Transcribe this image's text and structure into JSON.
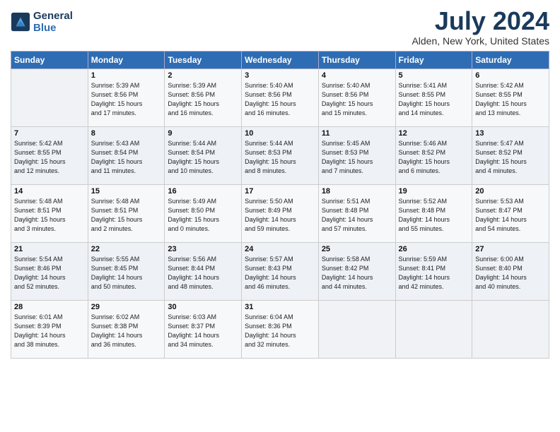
{
  "header": {
    "logo_line1": "General",
    "logo_line2": "Blue",
    "month_year": "July 2024",
    "location": "Alden, New York, United States"
  },
  "weekdays": [
    "Sunday",
    "Monday",
    "Tuesday",
    "Wednesday",
    "Thursday",
    "Friday",
    "Saturday"
  ],
  "weeks": [
    [
      {
        "day": "",
        "info": ""
      },
      {
        "day": "1",
        "info": "Sunrise: 5:39 AM\nSunset: 8:56 PM\nDaylight: 15 hours\nand 17 minutes."
      },
      {
        "day": "2",
        "info": "Sunrise: 5:39 AM\nSunset: 8:56 PM\nDaylight: 15 hours\nand 16 minutes."
      },
      {
        "day": "3",
        "info": "Sunrise: 5:40 AM\nSunset: 8:56 PM\nDaylight: 15 hours\nand 16 minutes."
      },
      {
        "day": "4",
        "info": "Sunrise: 5:40 AM\nSunset: 8:56 PM\nDaylight: 15 hours\nand 15 minutes."
      },
      {
        "day": "5",
        "info": "Sunrise: 5:41 AM\nSunset: 8:55 PM\nDaylight: 15 hours\nand 14 minutes."
      },
      {
        "day": "6",
        "info": "Sunrise: 5:42 AM\nSunset: 8:55 PM\nDaylight: 15 hours\nand 13 minutes."
      }
    ],
    [
      {
        "day": "7",
        "info": "Sunrise: 5:42 AM\nSunset: 8:55 PM\nDaylight: 15 hours\nand 12 minutes."
      },
      {
        "day": "8",
        "info": "Sunrise: 5:43 AM\nSunset: 8:54 PM\nDaylight: 15 hours\nand 11 minutes."
      },
      {
        "day": "9",
        "info": "Sunrise: 5:44 AM\nSunset: 8:54 PM\nDaylight: 15 hours\nand 10 minutes."
      },
      {
        "day": "10",
        "info": "Sunrise: 5:44 AM\nSunset: 8:53 PM\nDaylight: 15 hours\nand 8 minutes."
      },
      {
        "day": "11",
        "info": "Sunrise: 5:45 AM\nSunset: 8:53 PM\nDaylight: 15 hours\nand 7 minutes."
      },
      {
        "day": "12",
        "info": "Sunrise: 5:46 AM\nSunset: 8:52 PM\nDaylight: 15 hours\nand 6 minutes."
      },
      {
        "day": "13",
        "info": "Sunrise: 5:47 AM\nSunset: 8:52 PM\nDaylight: 15 hours\nand 4 minutes."
      }
    ],
    [
      {
        "day": "14",
        "info": "Sunrise: 5:48 AM\nSunset: 8:51 PM\nDaylight: 15 hours\nand 3 minutes."
      },
      {
        "day": "15",
        "info": "Sunrise: 5:48 AM\nSunset: 8:51 PM\nDaylight: 15 hours\nand 2 minutes."
      },
      {
        "day": "16",
        "info": "Sunrise: 5:49 AM\nSunset: 8:50 PM\nDaylight: 15 hours\nand 0 minutes."
      },
      {
        "day": "17",
        "info": "Sunrise: 5:50 AM\nSunset: 8:49 PM\nDaylight: 14 hours\nand 59 minutes."
      },
      {
        "day": "18",
        "info": "Sunrise: 5:51 AM\nSunset: 8:48 PM\nDaylight: 14 hours\nand 57 minutes."
      },
      {
        "day": "19",
        "info": "Sunrise: 5:52 AM\nSunset: 8:48 PM\nDaylight: 14 hours\nand 55 minutes."
      },
      {
        "day": "20",
        "info": "Sunrise: 5:53 AM\nSunset: 8:47 PM\nDaylight: 14 hours\nand 54 minutes."
      }
    ],
    [
      {
        "day": "21",
        "info": "Sunrise: 5:54 AM\nSunset: 8:46 PM\nDaylight: 14 hours\nand 52 minutes."
      },
      {
        "day": "22",
        "info": "Sunrise: 5:55 AM\nSunset: 8:45 PM\nDaylight: 14 hours\nand 50 minutes."
      },
      {
        "day": "23",
        "info": "Sunrise: 5:56 AM\nSunset: 8:44 PM\nDaylight: 14 hours\nand 48 minutes."
      },
      {
        "day": "24",
        "info": "Sunrise: 5:57 AM\nSunset: 8:43 PM\nDaylight: 14 hours\nand 46 minutes."
      },
      {
        "day": "25",
        "info": "Sunrise: 5:58 AM\nSunset: 8:42 PM\nDaylight: 14 hours\nand 44 minutes."
      },
      {
        "day": "26",
        "info": "Sunrise: 5:59 AM\nSunset: 8:41 PM\nDaylight: 14 hours\nand 42 minutes."
      },
      {
        "day": "27",
        "info": "Sunrise: 6:00 AM\nSunset: 8:40 PM\nDaylight: 14 hours\nand 40 minutes."
      }
    ],
    [
      {
        "day": "28",
        "info": "Sunrise: 6:01 AM\nSunset: 8:39 PM\nDaylight: 14 hours\nand 38 minutes."
      },
      {
        "day": "29",
        "info": "Sunrise: 6:02 AM\nSunset: 8:38 PM\nDaylight: 14 hours\nand 36 minutes."
      },
      {
        "day": "30",
        "info": "Sunrise: 6:03 AM\nSunset: 8:37 PM\nDaylight: 14 hours\nand 34 minutes."
      },
      {
        "day": "31",
        "info": "Sunrise: 6:04 AM\nSunset: 8:36 PM\nDaylight: 14 hours\nand 32 minutes."
      },
      {
        "day": "",
        "info": ""
      },
      {
        "day": "",
        "info": ""
      },
      {
        "day": "",
        "info": ""
      }
    ]
  ]
}
